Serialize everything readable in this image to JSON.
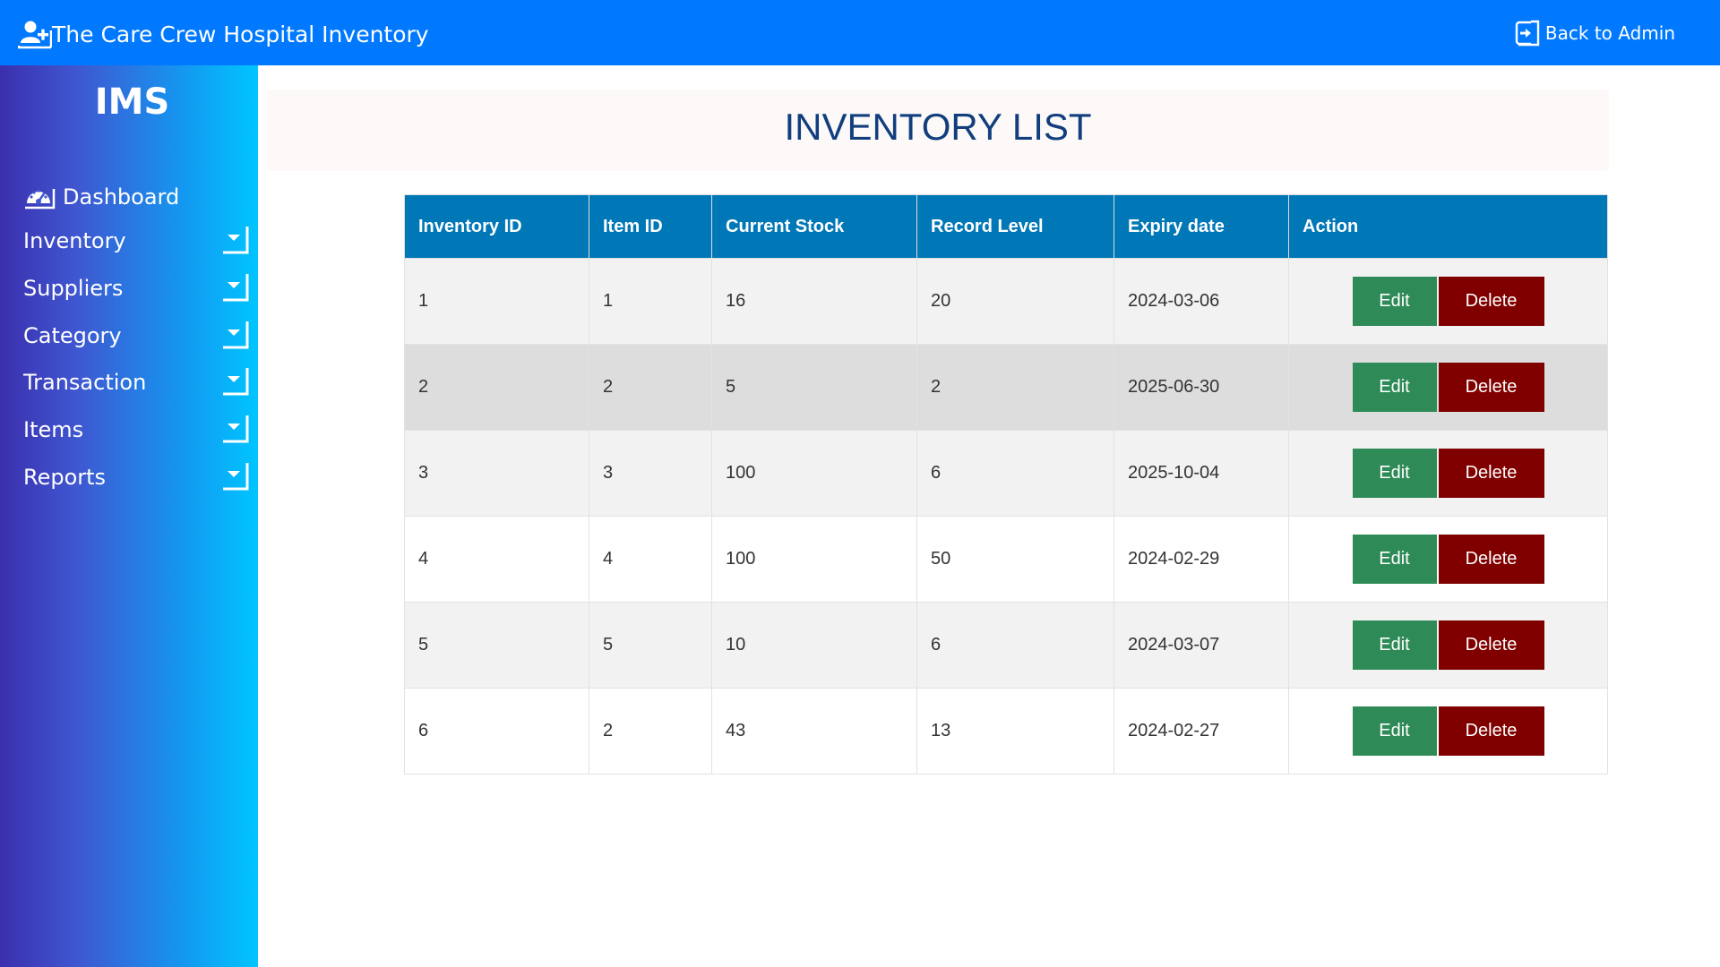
{
  "header": {
    "title": "The Care Crew Hospital Inventory",
    "brand_icon": "user-plus-icon",
    "back_label": "Back to Admin",
    "back_icon": "sign-out-icon",
    "bg_color": "#0179ff"
  },
  "sidebar": {
    "logo": "IMS",
    "dashboard": {
      "label": "Dashboard",
      "icon": "tachometer-icon"
    },
    "items": [
      {
        "label": "Inventory",
        "icon": "caret-down-icon"
      },
      {
        "label": "Suppliers",
        "icon": "caret-down-icon"
      },
      {
        "label": "Category",
        "icon": "caret-down-icon"
      },
      {
        "label": "Transaction",
        "icon": "caret-down-icon"
      },
      {
        "label": "Items",
        "icon": "caret-down-icon"
      },
      {
        "label": "Reports",
        "icon": "caret-down-icon"
      }
    ]
  },
  "main": {
    "page_title": "INVENTORY LIST",
    "table": {
      "columns": [
        "Inventory ID",
        "Item ID",
        "Current Stock",
        "Record Level",
        "Expiry date",
        "Action"
      ],
      "rows": [
        {
          "inventory_id": "1",
          "item_id": "1",
          "current_stock": "16",
          "record_level": "20",
          "expiry_date": "2024-03-06"
        },
        {
          "inventory_id": "2",
          "item_id": "2",
          "current_stock": "5",
          "record_level": "2",
          "expiry_date": "2025-06-30"
        },
        {
          "inventory_id": "3",
          "item_id": "3",
          "current_stock": "100",
          "record_level": "6",
          "expiry_date": "2025-10-04"
        },
        {
          "inventory_id": "4",
          "item_id": "4",
          "current_stock": "100",
          "record_level": "50",
          "expiry_date": "2024-02-29"
        },
        {
          "inventory_id": "5",
          "item_id": "5",
          "current_stock": "10",
          "record_level": "6",
          "expiry_date": "2024-03-07"
        },
        {
          "inventory_id": "6",
          "item_id": "2",
          "current_stock": "43",
          "record_level": "13",
          "expiry_date": "2024-02-27"
        }
      ],
      "edit_label": "Edit",
      "delete_label": "Delete",
      "header_color": "#0077b7",
      "edit_color": "#2e8b57",
      "delete_color": "#800000"
    }
  }
}
